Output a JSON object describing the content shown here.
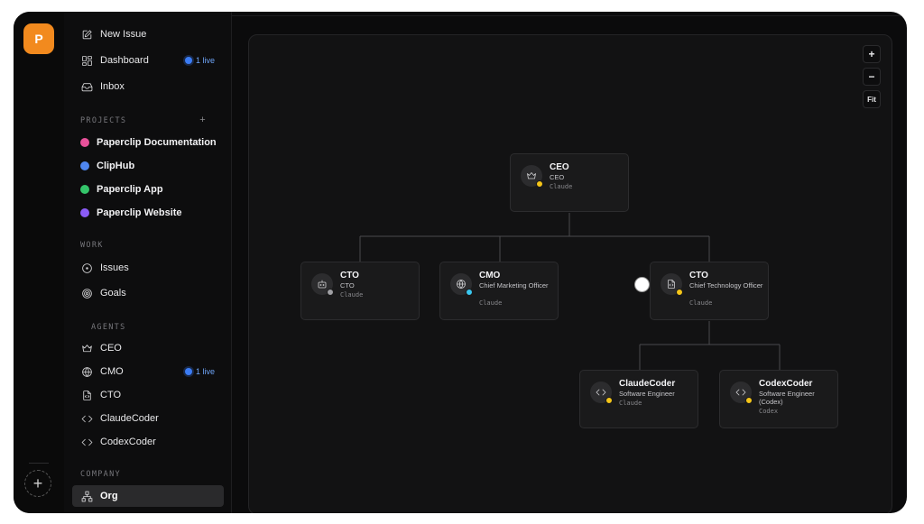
{
  "rail": {
    "logo_letter": "P",
    "add_label": "+"
  },
  "sidebar": {
    "top_items": [
      {
        "label": "New Issue",
        "icon": "edit-icon"
      },
      {
        "label": "Dashboard",
        "icon": "dashboard-icon",
        "badge": "1 live"
      },
      {
        "label": "Inbox",
        "icon": "inbox-icon"
      }
    ],
    "projects_heading": "PROJECTS",
    "projects_add": "+",
    "projects": [
      {
        "label": "Paperclip Documentation",
        "color": "#e8519a"
      },
      {
        "label": "ClipHub",
        "color": "#4f86f0"
      },
      {
        "label": "Paperclip App",
        "color": "#34c46a"
      },
      {
        "label": "Paperclip Website",
        "color": "#8b5cf6"
      }
    ],
    "work_heading": "WORK",
    "work_items": [
      {
        "label": "Issues",
        "icon": "circle-dot-icon"
      },
      {
        "label": "Goals",
        "icon": "target-icon"
      }
    ],
    "agents_heading": "AGENTS",
    "agents": [
      {
        "label": "CEO",
        "icon": "crown-icon"
      },
      {
        "label": "CMO",
        "icon": "globe-icon",
        "badge": "1 live"
      },
      {
        "label": "CTO",
        "icon": "file-code-icon"
      },
      {
        "label": "ClaudeCoder",
        "icon": "code-icon"
      },
      {
        "label": "CodexCoder",
        "icon": "code-icon"
      }
    ],
    "company_heading": "COMPANY",
    "company_items": [
      {
        "label": "Org",
        "icon": "org-icon",
        "active": true
      }
    ]
  },
  "zoom": {
    "in": "+",
    "out": "−",
    "fit": "Fit"
  },
  "org": {
    "nodes": [
      {
        "id": "ceo",
        "name": "CEO",
        "role": "CEO",
        "model": "Claude",
        "icon": "crown-icon",
        "status_color": "#f5c518"
      },
      {
        "id": "cto1",
        "name": "CTO",
        "role": "CTO",
        "model": "Claude",
        "icon": "bot-icon",
        "status_color": "#a0a0a4"
      },
      {
        "id": "cmo",
        "name": "CMO",
        "role": "Chief Marketing Officer",
        "model": "Claude",
        "icon": "globe-icon",
        "status_color": "#3ac8f0"
      },
      {
        "id": "cto2",
        "name": "CTO",
        "role": "Chief Technology Officer",
        "model": "Claude",
        "icon": "file-code-icon",
        "status_color": "#f5c518"
      },
      {
        "id": "claudecoder",
        "name": "ClaudeCoder",
        "role": "Software Engineer",
        "model": "Claude",
        "icon": "code-icon",
        "status_color": "#f5c518"
      },
      {
        "id": "codexcoder",
        "name": "CodexCoder",
        "role": "Software Engineer (Codex)",
        "model": "Codex",
        "icon": "code-icon",
        "status_color": "#f5c518"
      }
    ]
  }
}
